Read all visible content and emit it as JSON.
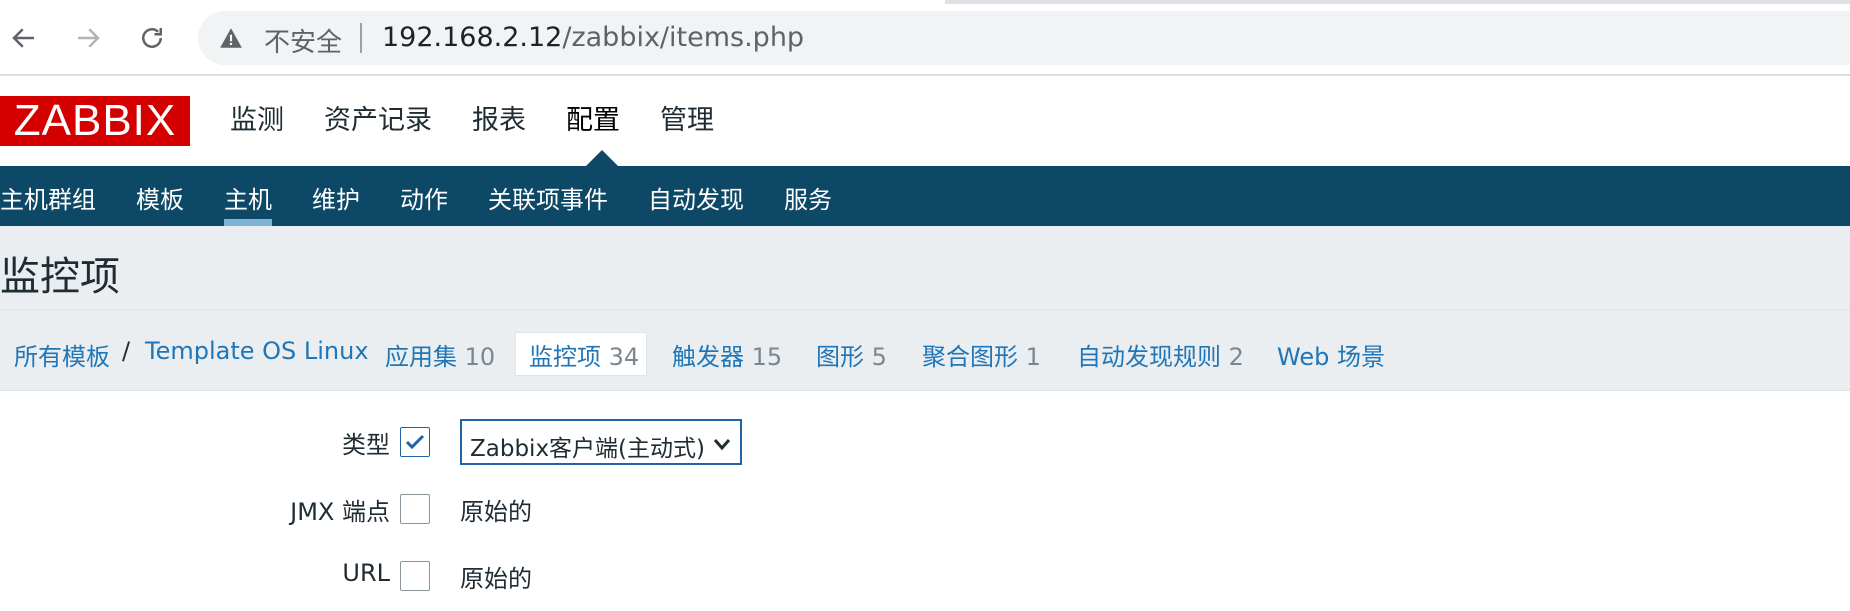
{
  "browser": {
    "insecure_label": "不安全",
    "url_host": "192.168.2.12",
    "url_path": "/zabbix/items.php"
  },
  "app": {
    "logo": "ZABBIX",
    "main_menu": [
      "监测",
      "资产记录",
      "报表",
      "配置",
      "管理"
    ],
    "selected_main": "配置",
    "sub_menu": [
      "主机群组",
      "模板",
      "主机",
      "维护",
      "动作",
      "关联项事件",
      "自动发现",
      "服务"
    ],
    "selected_sub": "主机"
  },
  "page": {
    "title": "监控项"
  },
  "breadcrumbs": {
    "all_templates": "所有模板",
    "separator": "/",
    "template": "Template OS Linux",
    "tabs": [
      {
        "label": "应用集",
        "count": "10"
      },
      {
        "label": "监控项",
        "count": "34"
      },
      {
        "label": "触发器",
        "count": "15"
      },
      {
        "label": "图形",
        "count": "5"
      },
      {
        "label": "聚合图形",
        "count": "1"
      },
      {
        "label": "自动发现规则",
        "count": "2"
      },
      {
        "label": "Web 场景",
        "count": ""
      }
    ],
    "active_tab": "监控项"
  },
  "form": {
    "type": {
      "label": "类型",
      "checked": true,
      "value": "Zabbix客户端(主动式)"
    },
    "jmx": {
      "label": "JMX 端点",
      "checked": false,
      "value": "原始的"
    },
    "url": {
      "label": "URL",
      "checked": false,
      "value": "原始的"
    }
  },
  "colors": {
    "brand_red": "#d40000",
    "subnav_bg": "#0e4867",
    "link_blue": "#1f76b8"
  }
}
